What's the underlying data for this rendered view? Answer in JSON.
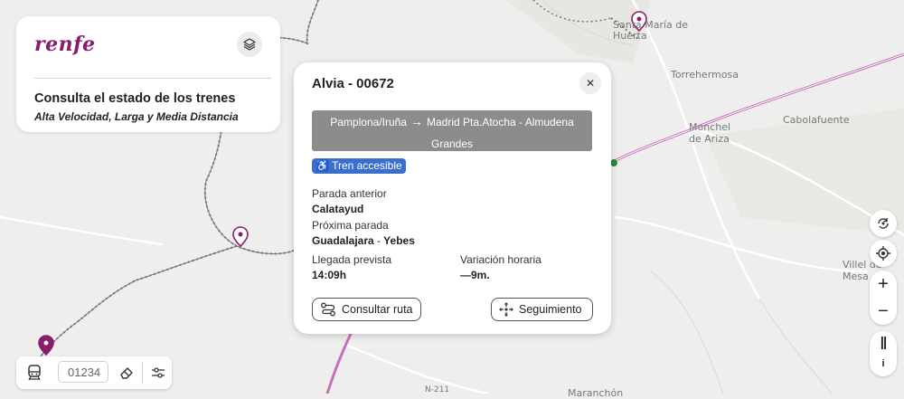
{
  "map": {
    "places": [
      "Santa María de Huerta",
      "Torrehermosa",
      "Monchel de Ariza",
      "Cabolafuente",
      "Villel de Mesa",
      "N-211",
      "Maranchón"
    ]
  },
  "brand": {
    "logo_text": "renfe",
    "title": "Consulta el estado de los trenes",
    "subtitle": "Alta Velocidad, Larga y Media Distancia"
  },
  "card": {
    "title": "Alvia - 00672",
    "close_symbol": "✕",
    "route": {
      "origin": "Pamplona/Iruña",
      "arrow": "→",
      "destination": "Madrid Pta.Atocha - Almudena Grandes"
    },
    "accessible_label": "Tren accesible",
    "previous_stop_label": "Parada anterior",
    "previous_stop": "Calatayud",
    "next_stop_label": "Próxima parada",
    "next_stop_a": "Guadalajara",
    "next_stop_sep": "-",
    "next_stop_b": "Yebes",
    "arrival_label": "Llegada prevista",
    "arrival_time": "14:09h",
    "variation_label": "Variación horaria",
    "variation_value": "—9m.",
    "route_button": "Consultar ruta",
    "follow_button": "Seguimiento"
  },
  "controls": {
    "zoom_in": "+",
    "zoom_out": "−",
    "pause": "||",
    "info": "i"
  },
  "search": {
    "placeholder": "01234"
  },
  "colors": {
    "brand": "#8a1c6e",
    "accessible": "#3b6fce",
    "route_box": "#8c8c8c",
    "hsr_line": "#c470bd"
  }
}
